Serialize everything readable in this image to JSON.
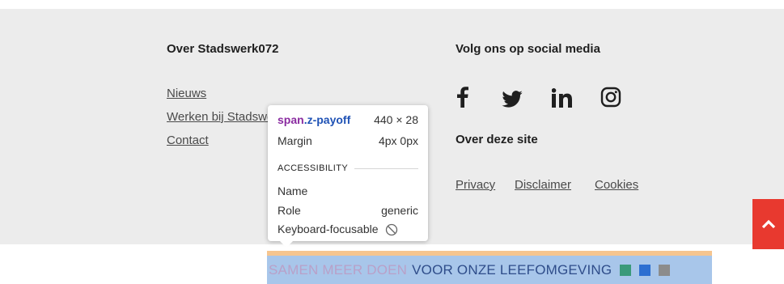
{
  "footer": {
    "col1": {
      "heading": "Over Stadswerk072",
      "links": [
        "Nieuws",
        "Werken bij Stadswerk072",
        "Contact"
      ]
    },
    "col2": {
      "heading": "Volg ons op social media",
      "social_icons": [
        "facebook-icon",
        "twitter-icon",
        "linkedin-icon",
        "instagram-icon"
      ],
      "site_heading": "Over deze site",
      "site_links": [
        "Privacy",
        "Disclaimer",
        "Cookies"
      ]
    },
    "scroll_top_icon": "chevron-up-icon"
  },
  "tooltip": {
    "selector_tag": "span",
    "selector_class": ".z-payoff",
    "size": "440 × 28",
    "margin_label": "Margin",
    "margin_value": "4px 0px",
    "section_title": "ACCESSIBILITY",
    "name_label": "Name",
    "name_value": "",
    "role_label": "Role",
    "role_value": "generic",
    "focusable_label": "Keyboard-focusable",
    "focusable_icon": "not-allowed-icon"
  },
  "payoff": {
    "part1": "SAMEN MEER DOEN",
    "part2": "VOOR ONZE LEEFOMGEVING",
    "square_colors": [
      "#3b9a7a",
      "#2d6fd1",
      "#8c8c8c"
    ]
  },
  "colors": {
    "footer_bg": "#ececec",
    "scroll_top_bg": "#e8392f",
    "highlight_content": "#a8c6ea",
    "highlight_margin": "#f6c58f"
  }
}
